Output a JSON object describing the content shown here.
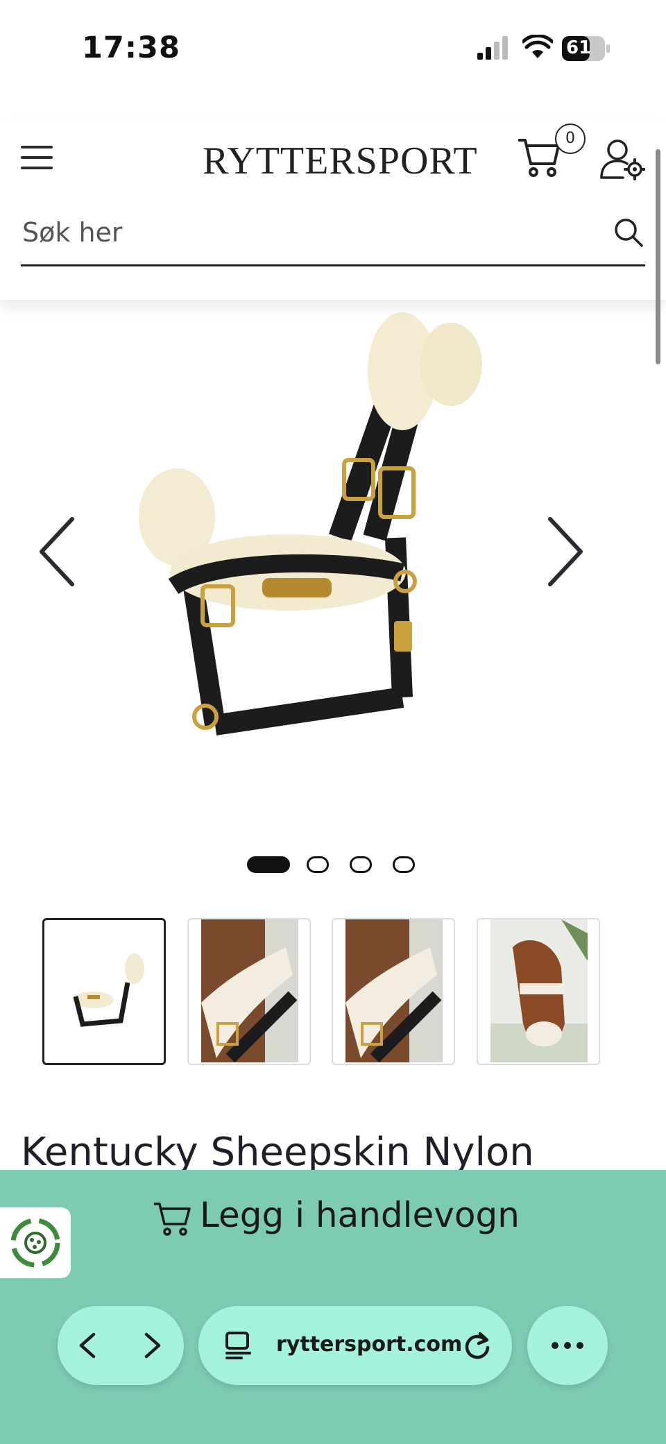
{
  "status_bar": {
    "time": "17:38",
    "battery": "61"
  },
  "header": {
    "logo": "RYTTERSPORT",
    "cart_count": "0",
    "search_placeholder": "Søk her"
  },
  "product": {
    "title": "Kentucky Sheepskin Nylon",
    "gallery": {
      "slides": 4,
      "active_index": 0
    },
    "thumbnails": [
      "halter-product-thumb",
      "halter-on-horse-thumb",
      "halter-on-horse-thumb",
      "horse-wearing-halter-thumb"
    ]
  },
  "actions": {
    "add_to_cart": "Legg i handlevogn"
  },
  "browser": {
    "url": "ryttersport.com"
  },
  "colors": {
    "bottom_bar": "#7ecbb4",
    "pill": "#a4f2dc",
    "text": "#1f1f24"
  },
  "icons": [
    "menu-icon",
    "cart-icon",
    "account-settings-icon",
    "search-icon",
    "chevron-left-icon",
    "chevron-right-icon",
    "recycle-icon",
    "tabs-icon",
    "reload-icon",
    "more-icon"
  ]
}
